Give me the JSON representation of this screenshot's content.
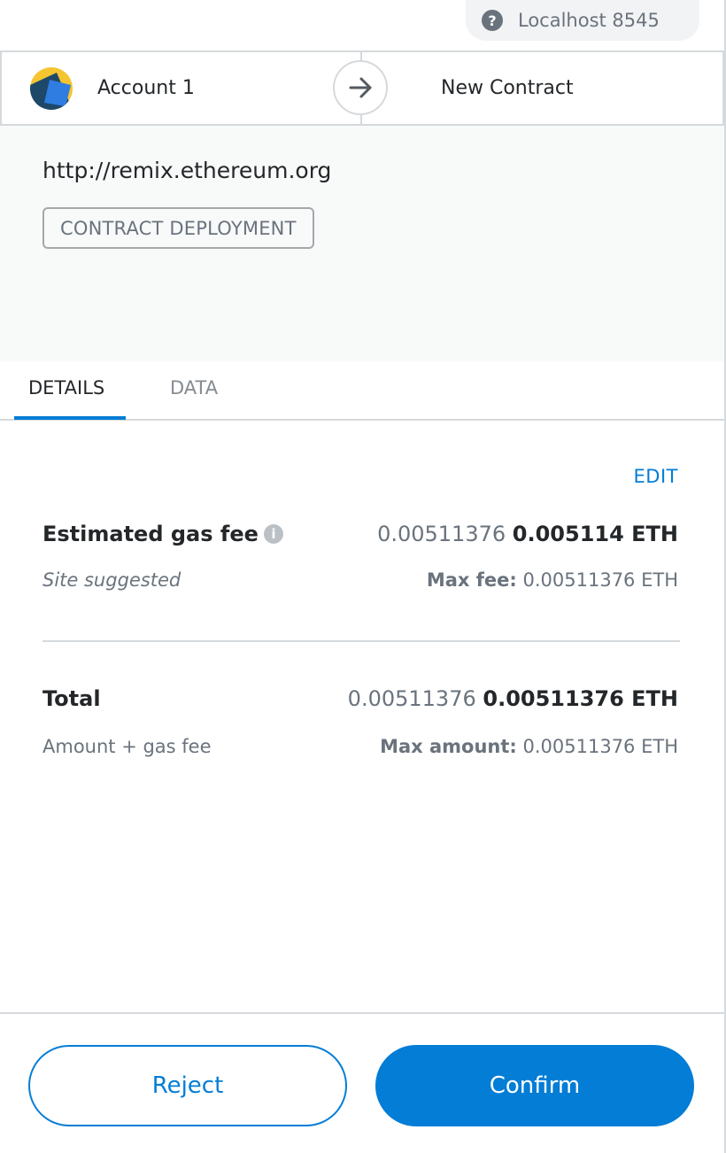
{
  "network": {
    "label": "Localhost 8545",
    "help_icon": "question-circle-icon"
  },
  "parties": {
    "sender": "Account 1",
    "recipient": "New Contract",
    "arrow_icon": "arrow-right-icon"
  },
  "origin": {
    "url": "http://remix.ethereum.org",
    "action": "CONTRACT DEPLOYMENT"
  },
  "tabs": [
    {
      "label": "DETAILS",
      "active": true
    },
    {
      "label": "DATA",
      "active": false
    }
  ],
  "details": {
    "edit_label": "EDIT",
    "gas": {
      "title": "Estimated gas fee",
      "info_icon": "info-icon",
      "secondary_value": "0.00511376",
      "primary_value": "0.005114 ETH",
      "sub_label": "Site suggested",
      "max_label": "Max fee:",
      "max_value": "0.00511376 ETH"
    },
    "total": {
      "title": "Total",
      "secondary_value": "0.00511376",
      "primary_value": "0.00511376 ETH",
      "sub_label": "Amount + gas fee",
      "max_label": "Max amount:",
      "max_value": "0.00511376 ETH"
    }
  },
  "footer": {
    "reject_label": "Reject",
    "confirm_label": "Confirm"
  },
  "colors": {
    "accent": "#037dd6",
    "text": "#24272a",
    "muted": "#6a737d"
  }
}
